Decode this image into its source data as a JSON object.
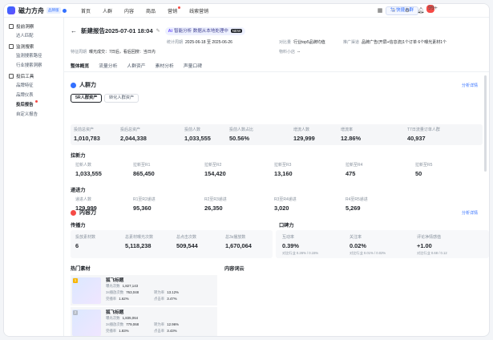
{
  "brand": {
    "name": "磁力方舟",
    "tag": "品牌版"
  },
  "topnav": [
    "首页",
    "人群",
    "内容",
    "商品",
    "营销",
    "线索营销"
  ],
  "topright": {
    "switch_label": "快捷入群",
    "notif_count": "99+"
  },
  "sidebar": {
    "groups": [
      {
        "label": "投前洞察",
        "items": [
          "达人匹配"
        ]
      },
      {
        "label": "监测搜索",
        "items": [
          "监测搜索路径",
          "行业搜索洞察"
        ]
      },
      {
        "label": "投后工具",
        "items": [
          "品牌特征",
          "品牌仪表",
          "投后报告",
          "自定义报告"
        ]
      }
    ],
    "active_item": "投后报告"
  },
  "header": {
    "title": "新建报告2025-07-01 18:04",
    "ai_label": "智能分析",
    "ai_text": "数据从本地处理中",
    "ai_tag": "NEW"
  },
  "meta": {
    "stat_period_label": "统计周期",
    "stat_period_value": "2025-06-18 至 2025-06-26",
    "target_label": "对比量",
    "target_value": "行业top5品牌均值",
    "channel_label": "推广渠道",
    "channel_value": "品牌广告(开屏+信息流)1个订单 6个曝光素材1个",
    "feature_label": "特征周期",
    "feature_value": "曝光成交：7日后，看后回搜：当日内",
    "material_label": "物料小店",
    "material_value": "--"
  },
  "tabs": [
    "整体概览",
    "流量分析",
    "人群资产",
    "素材分析",
    "声量口碑"
  ],
  "crowd": {
    "title": "人群力",
    "analyze": "分析详情",
    "pills": [
      "5R人群资产",
      "转化人群资产"
    ],
    "stats": [
      {
        "label": "投前总资产",
        "value": "1,010,783"
      },
      {
        "label": "投后总资产",
        "value": "2,044,338"
      },
      {
        "label": "投前人数",
        "value": "1,033,555"
      },
      {
        "label": "投前人数占比",
        "value": "50.56%"
      },
      {
        "label": "增流人数",
        "value": "129,999"
      },
      {
        "label": "增流率",
        "value": "12.86%"
      },
      {
        "label": "T7日流量订单人群",
        "value": "40,937"
      }
    ],
    "pull_title": "拉新力",
    "pull": [
      {
        "label": "拉新人数",
        "value": "1,033,555"
      },
      {
        "label": "拉新至R1",
        "value": "865,450"
      },
      {
        "label": "拉新至R2",
        "value": "154,420"
      },
      {
        "label": "拉新至R3",
        "value": "13,160"
      },
      {
        "label": "拉新至R4",
        "value": "475"
      },
      {
        "label": "拉新至R5",
        "value": "50"
      }
    ],
    "flow_title": "递进力",
    "flow": [
      {
        "label": "递进人数",
        "value": "129,999"
      },
      {
        "label": "R1至R2递进",
        "value": "95,360"
      },
      {
        "label": "R2至R3递进",
        "value": "26,350"
      },
      {
        "label": "R3至R4递进",
        "value": "3,020"
      },
      {
        "label": "R4至R5递进",
        "value": "5,269"
      }
    ]
  },
  "content": {
    "title": "内容力",
    "analyze": "分析详情",
    "spread_title": "传播力",
    "spread": [
      {
        "label": "投放素材数",
        "value": "6"
      },
      {
        "label": "总素材曝光次数",
        "value": "5,118,238"
      },
      {
        "label": "总点击次数",
        "value": "509,544"
      },
      {
        "label": "总3s播放数",
        "value": "1,670,064"
      }
    ],
    "word_title": "口碑力",
    "word": [
      {
        "label": "互动率",
        "value": "0.39%",
        "sub": "对比行业 0.26% / 0.15%"
      },
      {
        "label": "关注率",
        "value": "0.02%",
        "sub": "对比行业 0.01% / 0.02%"
      },
      {
        "label": "评论净情感值",
        "value": "+1.00",
        "sub": "对比行业 0.68 / 0.12"
      }
    ],
    "hot_title": "热门素材",
    "words_title": "内容词云",
    "materials": [
      {
        "rank": "1",
        "title": "狐飞标题",
        "r1": [
          "曝光次数",
          "1,827,143"
        ],
        "r2": [
          "3s播放次数",
          "763,048",
          "转为率",
          "13.12%"
        ],
        "r3": [
          "完播率",
          "1.62%",
          "点击率",
          "3.47%"
        ]
      },
      {
        "rank": "2",
        "title": "狐飞标题",
        "r1": [
          "曝光次数",
          "1,835,064"
        ],
        "r2": [
          "3s播放次数",
          "779,068",
          "转为率",
          "12.96%"
        ],
        "r3": [
          "完播率",
          "1.83%",
          "点击率",
          "3.43%"
        ]
      }
    ]
  }
}
